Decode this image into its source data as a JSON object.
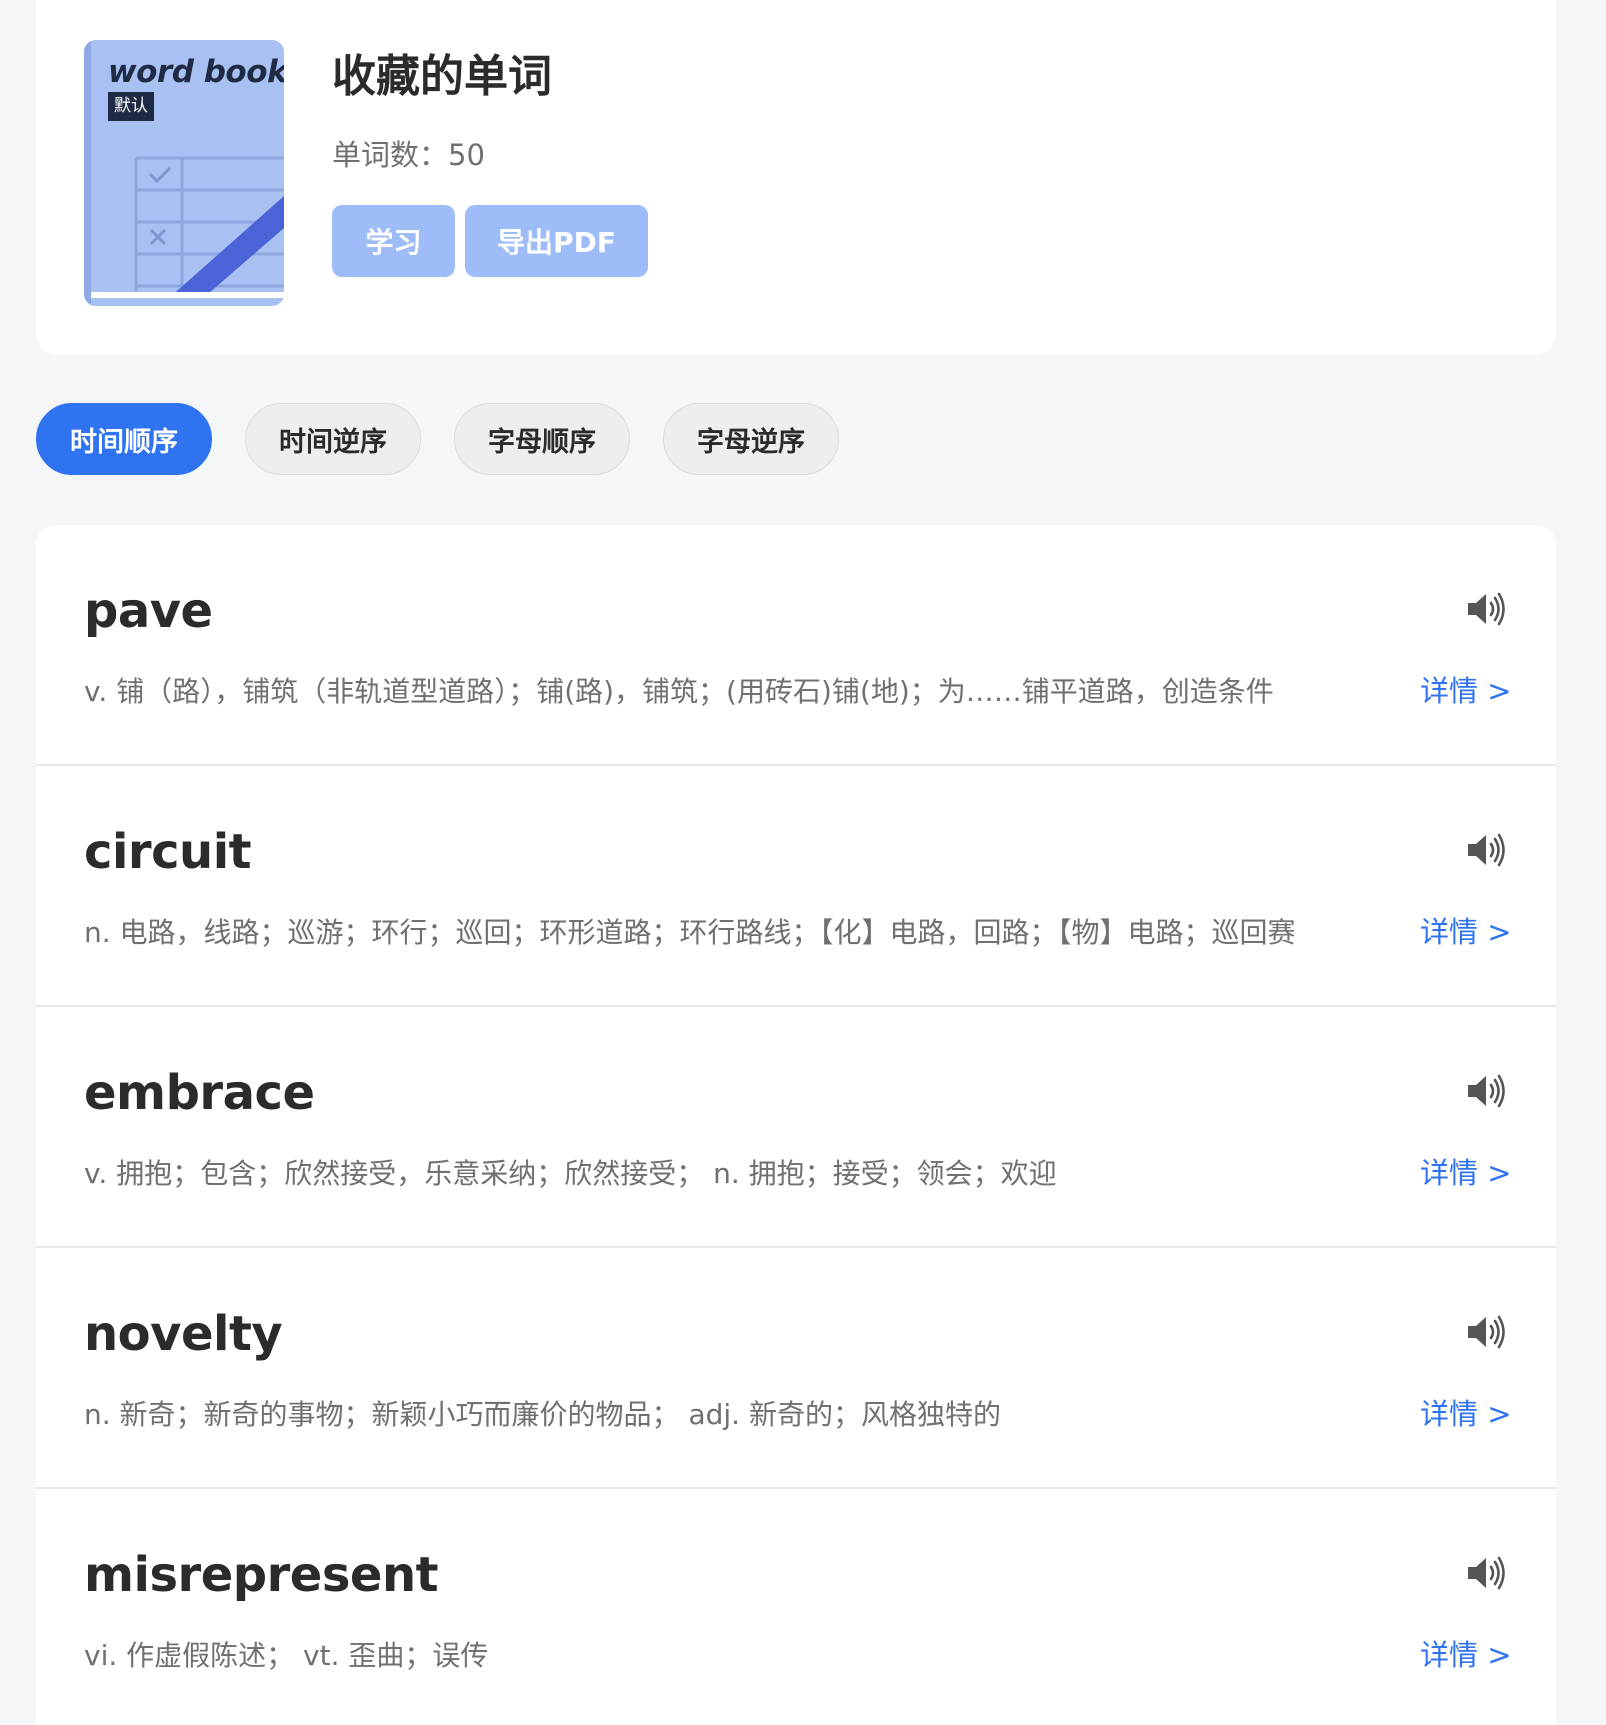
{
  "book": {
    "cover_title": "word book",
    "cover_tag": "默认",
    "title": "收藏的单词",
    "count_label": "单词数：",
    "count_value": "50",
    "learn_button": "学习",
    "export_button": "导出PDF"
  },
  "sort_tabs": [
    {
      "label": "时间顺序",
      "active": true
    },
    {
      "label": "时间逆序",
      "active": false
    },
    {
      "label": "字母顺序",
      "active": false
    },
    {
      "label": "字母逆序",
      "active": false
    }
  ],
  "detail_label": "详情 >",
  "words": [
    {
      "word": "pave",
      "definition": "v. 铺（路），铺筑（非轨道型道路）；铺(路)，铺筑；(用砖石)铺(地)；为……铺平道路，创造条件"
    },
    {
      "word": "circuit",
      "definition": "n. 电路，线路；巡游；环行；巡回；环形道路；环行路线；【化】电路，回路；【物】电路；巡回赛"
    },
    {
      "word": "embrace",
      "definition": "v. 拥抱；包含；欣然接受，乐意采纳；欣然接受；  n. 拥抱；接受；领会；欢迎"
    },
    {
      "word": "novelty",
      "definition": "n. 新奇；新奇的事物；新颖小巧而廉价的物品；  adj. 新奇的；风格独特的"
    },
    {
      "word": "misrepresent",
      "definition": "vi. 作虚假陈述；  vt. 歪曲；误传"
    }
  ],
  "icons": {
    "speaker": "speaker-icon",
    "cover": "book-cover-illustration"
  },
  "colors": {
    "accent": "#2f73f0",
    "button_disabled": "#9ebdf8",
    "cover": "#a9c1f2",
    "cover_stripe": "#4a64d8"
  }
}
